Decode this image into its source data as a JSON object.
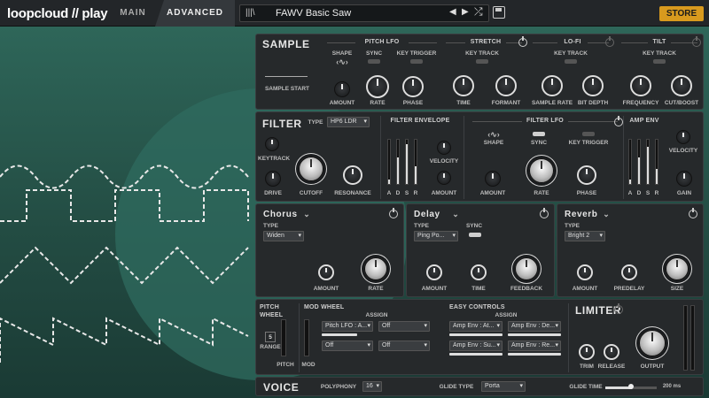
{
  "topbar": {
    "logo": "loopcloud // play",
    "tabs": {
      "main": "MAIN",
      "advanced": "ADVANCED"
    },
    "preset_name": "FAWV Basic Saw",
    "prev": "◀",
    "next": "▶",
    "shuffle": "⤮",
    "store": "STORE"
  },
  "sample": {
    "title": "SAMPLE",
    "sample_start": "SAMPLE START",
    "pitch_lfo": {
      "title": "PITCH LFO",
      "shape": "SHAPE",
      "sync": "SYNC",
      "key_trigger": "KEY TRIGGER",
      "amount": "AMOUNT",
      "rate": "RATE",
      "phase": "PHASE"
    },
    "stretch": {
      "title": "STRETCH",
      "key_track": "KEY TRACK",
      "time": "TIME",
      "formant": "FORMANT"
    },
    "lofi": {
      "title": "LO-FI",
      "key_track": "KEY TRACK",
      "sample_rate": "SAMPLE RATE",
      "bit_depth": "BIT DEPTH"
    },
    "tilt": {
      "title": "TILT",
      "key_track": "KEY TRACK",
      "frequency": "FREQUENCY",
      "cut_boost": "CUT/BOOST"
    }
  },
  "filter": {
    "title": "FILTER",
    "type_label": "TYPE",
    "type_value": "HP6 LDR",
    "keytrack": "KEYTRACK",
    "drive": "DRIVE",
    "cutoff": "CUTOFF",
    "resonance": "RESONANCE",
    "envelope": {
      "title": "FILTER ENVELOPE",
      "a": "A",
      "d": "D",
      "s": "S",
      "r": "R",
      "velocity": "VELOCITY",
      "amount": "AMOUNT"
    },
    "lfo": {
      "title": "FILTER LFO",
      "shape": "SHAPE",
      "sync": "SYNC",
      "key_trigger": "KEY TRIGGER",
      "amount": "AMOUNT",
      "rate": "RATE",
      "phase": "PHASE"
    },
    "amp_env": {
      "title": "AMP ENV",
      "a": "A",
      "d": "D",
      "s": "S",
      "r": "R",
      "velocity": "VELOCITY",
      "gain": "GAIN"
    }
  },
  "effects": {
    "chorus": {
      "title": "Chorus",
      "type_label": "TYPE",
      "type_value": "Widen",
      "amount": "AMOUNT",
      "rate": "RATE"
    },
    "delay": {
      "title": "Delay",
      "type_label": "TYPE",
      "type_value": "Ping Po...",
      "sync": "SYNC",
      "amount": "AMOUNT",
      "time": "TIME",
      "feedback": "FEEDBACK"
    },
    "reverb": {
      "title": "Reverb",
      "type_label": "TYPE",
      "type_value": "Bright 2",
      "amount": "AMOUNT",
      "predelay": "PREDELAY",
      "size": "SIZE"
    }
  },
  "controls": {
    "pitch_wheel": "PITCH WHEEL",
    "range_value": "5",
    "range": "RANGE",
    "pitch": "PITCH",
    "mod_wheel": "MOD WHEEL",
    "assign": "ASSIGN",
    "mod": "MOD",
    "mod_assign": [
      "Pitch LFO : A...",
      "Off",
      "Off",
      "Off"
    ],
    "easy_controls": "EASY CONTROLS",
    "easy_assign": "ASSIGN",
    "easy_slots": [
      "Amp Env : At...",
      "Amp Env : De...",
      "Amp Env : Su...",
      "Amp Env : Re..."
    ],
    "limiter": "LIMITER",
    "trim": "TRIM",
    "release": "RELEASE",
    "output": "OUTPUT"
  },
  "voice": {
    "title": "VOICE",
    "polyphony_label": "POLYPHONY",
    "polyphony": "16",
    "glide_type_label": "GLIDE TYPE",
    "glide_type": "Porta",
    "glide_time_label": "GLIDE TIME",
    "glide_time": "200 ms"
  }
}
